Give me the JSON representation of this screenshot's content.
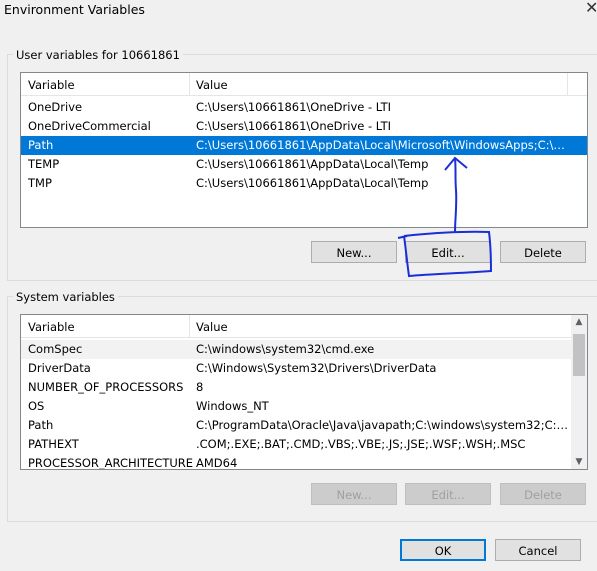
{
  "window": {
    "title": "Environment Variables",
    "close_glyph": "✕"
  },
  "user_group": {
    "label": "User variables for 10661861",
    "col_variable": "Variable",
    "col_value": "Value",
    "rows": [
      {
        "name": "OneDrive",
        "value": "C:\\Users\\10661861\\OneDrive - LTI"
      },
      {
        "name": "OneDriveCommercial",
        "value": "C:\\Users\\10661861\\OneDrive - LTI"
      },
      {
        "name": "Path",
        "value": "C:\\Users\\10661861\\AppData\\Local\\Microsoft\\WindowsApps;C:\\Use..."
      },
      {
        "name": "TEMP",
        "value": "C:\\Users\\10661861\\AppData\\Local\\Temp"
      },
      {
        "name": "TMP",
        "value": "C:\\Users\\10661861\\AppData\\Local\\Temp"
      }
    ],
    "selected_row": "Path",
    "buttons": {
      "new": "New...",
      "edit": "Edit...",
      "delete": "Delete"
    }
  },
  "system_group": {
    "label": "System variables",
    "col_variable": "Variable",
    "col_value": "Value",
    "rows": [
      {
        "name": "ComSpec",
        "value": "C:\\windows\\system32\\cmd.exe"
      },
      {
        "name": "DriverData",
        "value": "C:\\Windows\\System32\\Drivers\\DriverData"
      },
      {
        "name": "NUMBER_OF_PROCESSORS",
        "value": "8"
      },
      {
        "name": "OS",
        "value": "Windows_NT"
      },
      {
        "name": "Path",
        "value": "C:\\ProgramData\\Oracle\\Java\\javapath;C:\\windows\\system32;C:\\wi..."
      },
      {
        "name": "PATHEXT",
        "value": ".COM;.EXE;.BAT;.CMD;.VBS;.VBE;.JS;.JSE;.WSF;.WSH;.MSC"
      },
      {
        "name": "PROCESSOR_ARCHITECTURE",
        "value": "AMD64"
      }
    ],
    "buttons": {
      "new": "New...",
      "edit": "Edit...",
      "delete": "Delete"
    }
  },
  "footer": {
    "ok": "OK",
    "cancel": "Cancel"
  },
  "colors": {
    "selection": "#0078d7",
    "annotation_ink": "#1a2fd6"
  }
}
